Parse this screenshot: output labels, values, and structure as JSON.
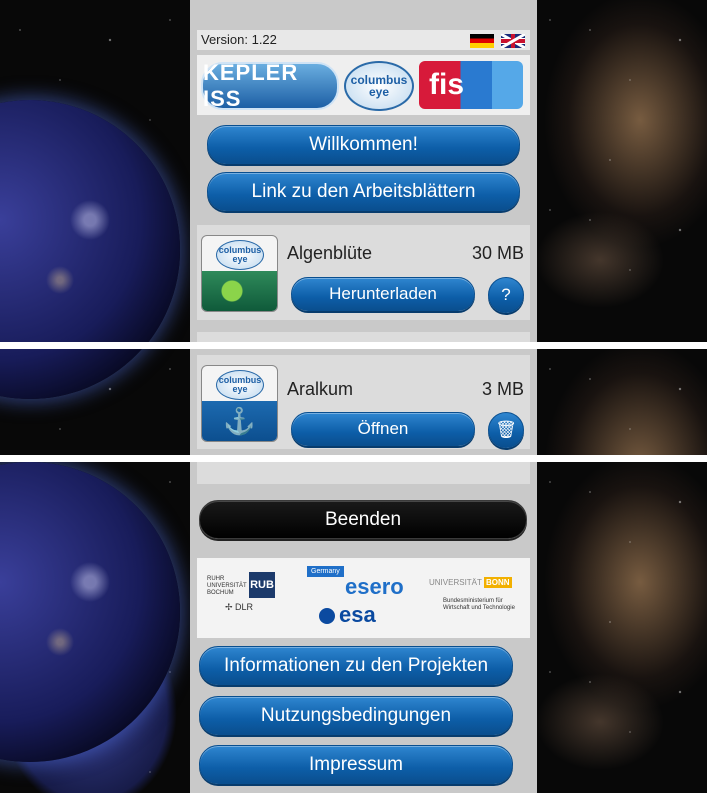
{
  "header": {
    "version": "Version: 1.22"
  },
  "logos": {
    "kepler": "KEPLER ISS",
    "columbus": "columbus eye",
    "fis": "fis"
  },
  "menu": {
    "welcome": "Willkommen!",
    "worksheets": "Link zu den Arbeitsblättern"
  },
  "items": [
    {
      "title": "Algenblüte",
      "size": "30 MB",
      "action": "Herunterladen",
      "help": "?"
    },
    {
      "title": "Aralkum",
      "size": "3 MB",
      "action": "Öffnen"
    }
  ],
  "footer": {
    "quit": "Beenden",
    "info": "Informationen zu den Projekten",
    "terms": "Nutzungsbedingungen",
    "imprint": "Impressum"
  },
  "sponsors": {
    "rub": "RUB",
    "rub_text": "RUHR UNIVERSITÄT BOCHUM",
    "esero_tag": "Germany",
    "esero": "esero",
    "bonn": "UNIVERSITÄT",
    "bonn_b": "BONN",
    "dlr": "DLR",
    "esa": "esa",
    "bmwi": "Bundesministerium für Wirtschaft und Technologie"
  },
  "colors": {
    "accent": "#0d5ea8",
    "panel": "#c9c9c9",
    "dark_button": "#000000"
  },
  "icons": [
    "flag-de-icon",
    "flag-uk-icon",
    "help-icon",
    "trash-icon",
    "anchor-icon"
  ]
}
